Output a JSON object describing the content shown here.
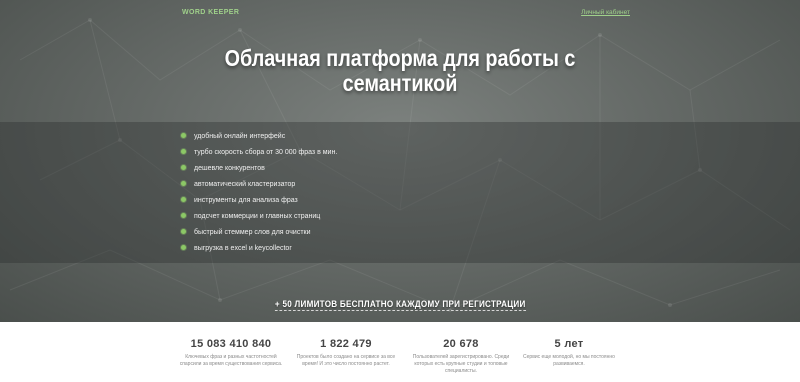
{
  "header": {
    "logo": "WORD KEEPER",
    "account_link": "Личный кабинет"
  },
  "hero": {
    "title_line1": "Облачная платформа для работы с",
    "title_line2": "семантикой"
  },
  "features": [
    "удобный онлайн интерфейс",
    "турбо скорость сбора от 30 000 фраз в мин.",
    "дешевле конкурентов",
    "автоматический кластеризатор",
    "инструменты для анализа фраз",
    "подсчет коммерции и главных страниц",
    "быстрый стеммер слов для очистки",
    "выгрузка в excel и keycollector"
  ],
  "promo": "+ 50 ЛИМИТОВ БЕСПЛАТНО КАЖДОМУ ПРИ РЕГИСТРАЦИИ",
  "stats": [
    {
      "value": "15 083 410 840",
      "desc_line1": "Ключевых фраз и разных частотностей",
      "desc_line2": "спарсили за время существования сервиса."
    },
    {
      "value": "1 822 479",
      "desc_line1": "Проектов было создано на сервисе за все",
      "desc_line2": "время! И это число постоянно растет."
    },
    {
      "value": "20 678",
      "desc_line1": "Пользователей зарегистрировано. Среди",
      "desc_line2": "которых есть крупные студии и топовые",
      "desc_line3": "специалисты."
    },
    {
      "value": "5 лет",
      "desc_line1": "Сервис еще молодой, но мы постоянно",
      "desc_line2": "развиваемся."
    }
  ],
  "colors": {
    "accent_green": "#8cc866",
    "link_green": "#9fd08a",
    "hero_bg": "#656a67"
  }
}
